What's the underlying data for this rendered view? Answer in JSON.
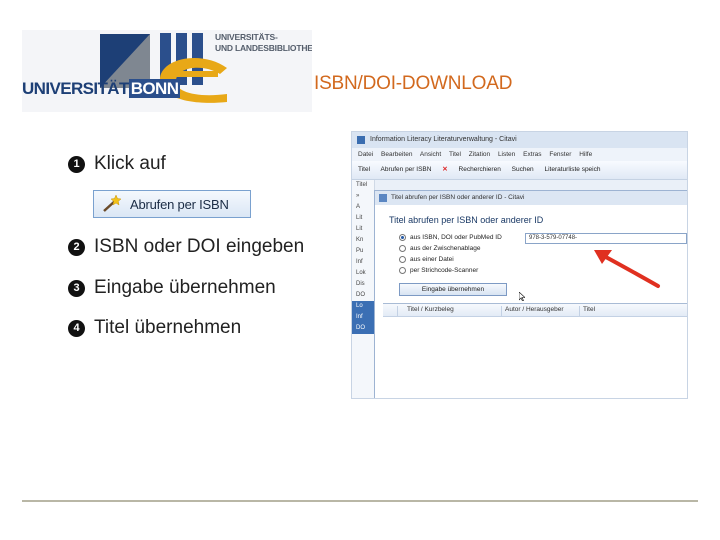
{
  "logo": {
    "name_left": "UNIVERSITÄT",
    "name_right": "BONN",
    "ulb_line1": "UNIVERSITÄTS-",
    "ulb_line2": "UND LANDESBIBLIOTHEK"
  },
  "slide_title": "ISBN/DOI-DOWNLOAD",
  "steps": [
    {
      "num": "1",
      "text": "Klick auf"
    },
    {
      "num": "2",
      "text": "ISBN oder DOI eingeben"
    },
    {
      "num": "3",
      "text": "Eingabe übernehmen"
    },
    {
      "num": "4",
      "text": "Titel übernehmen"
    }
  ],
  "isbn_button_label": "Abrufen per ISBN",
  "citavi": {
    "window_title": "Information Literacy Literaturverwaltung - Citavi",
    "menu": [
      "Datei",
      "Bearbeiten",
      "Ansicht",
      "Titel",
      "Zitation",
      "Listen",
      "Extras",
      "Fenster",
      "Hilfe"
    ],
    "toolbar": {
      "titel": "Titel",
      "abrufen": "Abrufen per ISBN",
      "recherchieren": "Recherchieren",
      "suchen": "Suchen",
      "literaturliste": "Literaturliste speich"
    },
    "side_items": [
      "Titel",
      "»",
      "A",
      "Lit",
      "Lit",
      "Kn",
      "Pu",
      "Inf",
      "Lok",
      "Dis",
      "DO",
      "Lo",
      "Inf",
      "DO"
    ],
    "dialog": {
      "title": "Titel abrufen per ISBN oder anderer ID - Citavi",
      "heading": "Titel abrufen per ISBN oder anderer ID",
      "options": [
        "aus ISBN, DOI oder PubMed ID",
        "aus der Zwischenablage",
        "aus einer Datei",
        "per Strichcode-Scanner"
      ],
      "input_value": "978-3-579-07748-",
      "accept_button": "Eingabe übernehmen",
      "columns": [
        "Titel / Kurzbeleg",
        "Autor / Herausgeber",
        "Titel"
      ]
    }
  },
  "colors": {
    "title_orange": "#d2691e",
    "logo_blue": "#1d3f76",
    "logo_yellow": "#e8a817",
    "arrow_red": "#e03020",
    "rule": "#b9b7a6"
  }
}
